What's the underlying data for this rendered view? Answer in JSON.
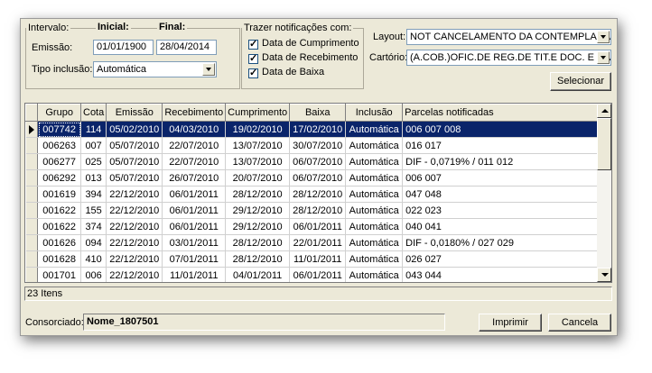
{
  "intervalo": {
    "legend": "Intervalo:",
    "inicial_label": "Inicial:",
    "final_label": "Final:",
    "emissao_label": "Emissão:",
    "emissao_inicial": "01/01/1900",
    "emissao_final": "28/04/2014",
    "tipo_inclusao_label": "Tipo inclusão:",
    "tipo_inclusao_value": "Automática"
  },
  "notificacoes": {
    "legend": "Trazer notificações com:",
    "options": [
      {
        "label": "Data de Cumprimento",
        "checked": true
      },
      {
        "label": "Data de Recebimento",
        "checked": true
      },
      {
        "label": "Data de Baixa",
        "checked": true
      }
    ]
  },
  "layout": {
    "label": "Layout:",
    "value": "NOT CANCELAMENTO DA CONTEMPLAÇÃO"
  },
  "cartorio": {
    "label": "Cartório:",
    "value": "(A.COB.)OFIC.DE REG.DE TIT.E DOC. E CIVIL I"
  },
  "selecionar_label": "Selecionar",
  "table": {
    "headers": [
      "Grupo",
      "Cota",
      "Emissão",
      "Recebimento",
      "Cumprimento",
      "Baixa",
      "Inclusão",
      "Parcelas notificadas"
    ],
    "rows": [
      [
        "007742",
        "114",
        "05/02/2010",
        "04/03/2010",
        "19/02/2010",
        "17/02/2010",
        "Automática",
        "006 007 008"
      ],
      [
        "006263",
        "007",
        "05/07/2010",
        "22/07/2010",
        "13/07/2010",
        "30/07/2010",
        "Automática",
        "016 017"
      ],
      [
        "006277",
        "025",
        "05/07/2010",
        "22/07/2010",
        "13/07/2010",
        "06/07/2010",
        "Automática",
        "DIF -  0,0719% / 011 012"
      ],
      [
        "006292",
        "013",
        "05/07/2010",
        "26/07/2010",
        "20/07/2010",
        "06/07/2010",
        "Automática",
        "006 007"
      ],
      [
        "001619",
        "394",
        "22/12/2010",
        "06/01/2011",
        "28/12/2010",
        "28/12/2010",
        "Automática",
        "047 048"
      ],
      [
        "001622",
        "155",
        "22/12/2010",
        "06/01/2011",
        "29/12/2010",
        "28/12/2010",
        "Automática",
        "022 023"
      ],
      [
        "001622",
        "374",
        "22/12/2010",
        "06/01/2011",
        "29/12/2010",
        "06/01/2011",
        "Automática",
        "040 041"
      ],
      [
        "001626",
        "094",
        "22/12/2010",
        "03/01/2011",
        "28/12/2010",
        "22/01/2011",
        "Automática",
        "DIF -  0,0180% / 027 029"
      ],
      [
        "001628",
        "410",
        "22/12/2010",
        "07/01/2011",
        "28/12/2010",
        "11/01/2011",
        "Automática",
        "026 027"
      ],
      [
        "001701",
        "006",
        "22/12/2010",
        "11/01/2011",
        "04/01/2011",
        "06/01/2011",
        "Automática",
        "043 044"
      ]
    ]
  },
  "status_count": "23 Itens",
  "consorciado": {
    "label": "Consorciado:",
    "value": "Nome_1807501"
  },
  "imprimir_label": "Imprimir",
  "cancela_label": "Cancela"
}
